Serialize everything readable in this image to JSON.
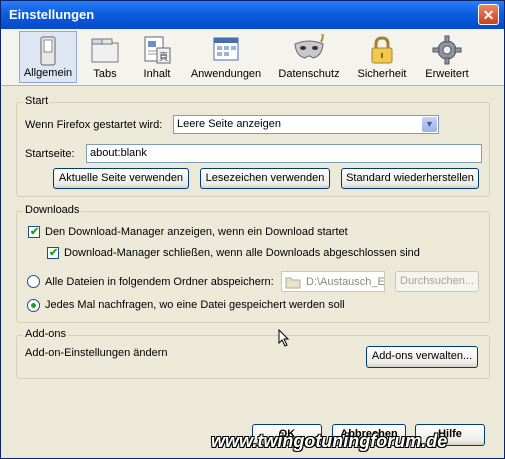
{
  "window": {
    "title": "Einstellungen",
    "close_glyph": "✕"
  },
  "tabs": [
    {
      "label": "Allgemein",
      "icon": "switch-icon",
      "selected": true
    },
    {
      "label": "Tabs",
      "icon": "tabs-icon",
      "selected": false
    },
    {
      "label": "Inhalt",
      "icon": "content-icon",
      "selected": false
    },
    {
      "label": "Anwendungen",
      "icon": "applications-icon",
      "selected": false
    },
    {
      "label": "Datenschutz",
      "icon": "mask-icon",
      "selected": false
    },
    {
      "label": "Sicherheit",
      "icon": "lock-icon",
      "selected": false
    },
    {
      "label": "Erweitert",
      "icon": "gear-icon",
      "selected": false
    }
  ],
  "start": {
    "legend": "Start",
    "when_starts_label": "Wenn Firefox gestartet wird:",
    "when_starts_value": "Leere Seite anzeigen",
    "homepage_label": "Startseite:",
    "homepage_value": "about:blank",
    "btn_current": "Aktuelle Seite verwenden",
    "btn_bookmark": "Lesezeichen verwenden",
    "btn_default": "Standard wiederherstellen"
  },
  "downloads": {
    "legend": "Downloads",
    "show_manager": "Den Download-Manager anzeigen, wenn ein Download startet",
    "close_manager": "Download-Manager schließen, wenn alle Downloads abgeschlossen sind",
    "save_all": "Alle Dateien in folgendem Ordner abspeichern:",
    "folder": "D:\\Austausch_E",
    "browse": "Durchsuchen...",
    "ask_each": "Jedes Mal nachfragen, wo eine Datei gespeichert werden soll"
  },
  "addons": {
    "legend": "Add-ons",
    "description": "Add-on-Einstellungen ändern",
    "manage": "Add-ons verwalten..."
  },
  "footer": {
    "ok": "OK",
    "cancel": "Abbrechen",
    "help": "Hilfe"
  },
  "watermark": "www.twingotuningforum.de",
  "colors": {
    "titlebar": "#0a5fe0",
    "dialog": "#ece9d8",
    "accent_check": "#21a121"
  }
}
